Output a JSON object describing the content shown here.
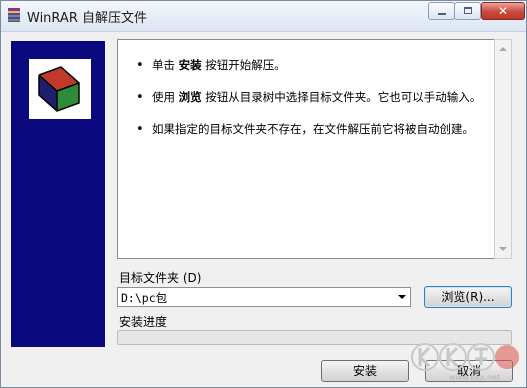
{
  "window": {
    "title": "WinRAR 自解压文件"
  },
  "info": {
    "items": [
      {
        "pre": "单击 ",
        "bold": "安装",
        "post": " 按钮开始解压。"
      },
      {
        "pre": "使用 ",
        "bold": "浏览",
        "post": " 按钮从目录树中选择目标文件夹。它也可以手动输入。"
      },
      {
        "pre": "如果指定的目标文件夹不存在，在文件解压前它将被自动创建。",
        "bold": "",
        "post": ""
      }
    ]
  },
  "destination": {
    "label": "目标文件夹 (D)",
    "value": "D:\\pc包",
    "browse_label": "浏览(R)..."
  },
  "progress": {
    "label": "安装进度",
    "percent": 0,
    "color": "#37b44a"
  },
  "buttons": {
    "install_label": "安装",
    "cancel_label": "取消"
  },
  "watermark": {
    "site": "www.kkx.net"
  },
  "colors": {
    "side_panel": "#0a0a7e",
    "close_button": "#c94a3c"
  }
}
